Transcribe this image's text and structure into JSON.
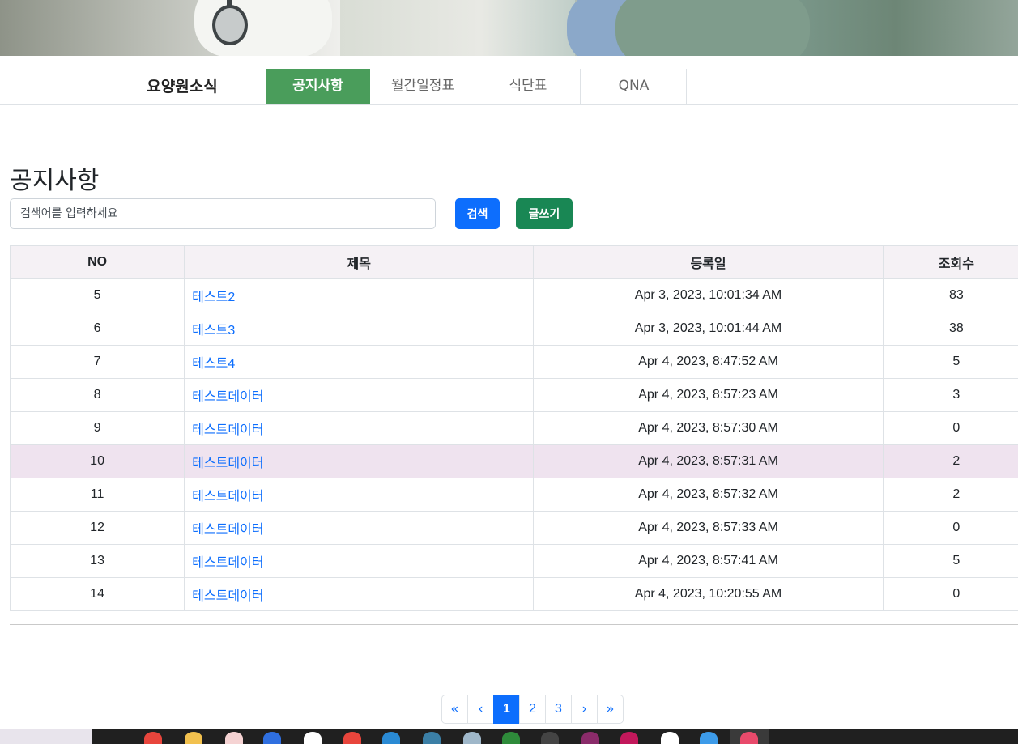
{
  "nav": {
    "brand": "요양원소식",
    "tabs": [
      {
        "label": "공지사항",
        "active": true
      },
      {
        "label": "월간일정표",
        "active": false
      },
      {
        "label": "식단표",
        "active": false
      },
      {
        "label": "QNA",
        "active": false
      }
    ]
  },
  "page": {
    "title": "공지사항"
  },
  "search": {
    "placeholder": "검색어를 입력하세요",
    "button_label": "검색",
    "write_label": "글쓰기"
  },
  "table": {
    "headers": {
      "no": "NO",
      "title": "제목",
      "date": "등록일",
      "views": "조회수"
    },
    "rows": [
      {
        "no": "5",
        "title": "테스트2",
        "date": "Apr 3, 2023, 10:01:34 AM",
        "views": "83"
      },
      {
        "no": "6",
        "title": "테스트3",
        "date": "Apr 3, 2023, 10:01:44 AM",
        "views": "38"
      },
      {
        "no": "7",
        "title": "테스트4",
        "date": "Apr 4, 2023, 8:47:52 AM",
        "views": "5"
      },
      {
        "no": "8",
        "title": "테스트데이터",
        "date": "Apr 4, 2023, 8:57:23 AM",
        "views": "3"
      },
      {
        "no": "9",
        "title": "테스트데이터",
        "date": "Apr 4, 2023, 8:57:30 AM",
        "views": "0"
      },
      {
        "no": "10",
        "title": "테스트데이터",
        "date": "Apr 4, 2023, 8:57:31 AM",
        "views": "2"
      },
      {
        "no": "11",
        "title": "테스트데이터",
        "date": "Apr 4, 2023, 8:57:32 AM",
        "views": "2"
      },
      {
        "no": "12",
        "title": "테스트데이터",
        "date": "Apr 4, 2023, 8:57:33 AM",
        "views": "0"
      },
      {
        "no": "13",
        "title": "테스트데이터",
        "date": "Apr 4, 2023, 8:57:41 AM",
        "views": "5"
      },
      {
        "no": "14",
        "title": "테스트데이터",
        "date": "Apr 4, 2023, 10:20:55 AM",
        "views": "0"
      }
    ]
  },
  "pagination": {
    "first": "«",
    "prev": "‹",
    "pages": [
      "1",
      "2",
      "3"
    ],
    "current": "1",
    "next": "›",
    "last": "»"
  },
  "colors": {
    "active_tab": "#4a9d5b",
    "search_button": "#0d6efd",
    "write_button": "#198754",
    "link": "#0d6efd",
    "row_highlight": "#efe3ef"
  },
  "taskbar": {
    "icons": [
      "chrome-icon",
      "folder-icon",
      "app-icon",
      "app-icon",
      "app-icon",
      "chrome-icon",
      "vscode-icon",
      "mysql-icon",
      "app-icon",
      "app-icon",
      "terminal-icon",
      "app-icon",
      "intellij-icon",
      "app-icon",
      "app-icon",
      "app-icon"
    ]
  }
}
